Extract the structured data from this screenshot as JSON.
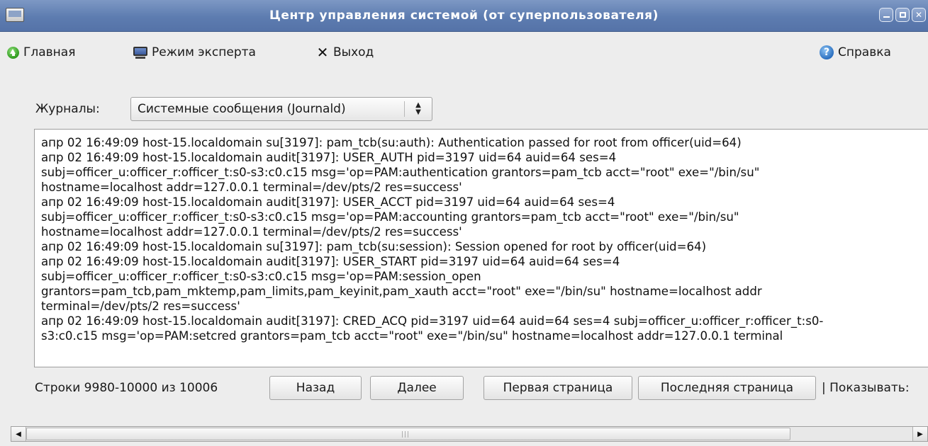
{
  "window": {
    "title": "Центр управления системой (от суперпользователя)",
    "buttons": {
      "minimize": "minimize",
      "maximize": "maximize",
      "close": "✕"
    }
  },
  "toolbar": {
    "home_label": "Главная",
    "expert_label": "Режим эксперта",
    "exit_label": "Выход",
    "help_label": "Справка"
  },
  "journals": {
    "label": "Журналы:",
    "selected": "Системные сообщения (Journald)"
  },
  "log": {
    "lines": [
      "апр 02 16:49:09 host-15.localdomain su[3197]: pam_tcb(su:auth): Authentication passed for root from officer(uid=64)",
      "апр 02 16:49:09 host-15.localdomain audit[3197]: USER_AUTH pid=3197 uid=64 auid=64 ses=4",
      "subj=officer_u:officer_r:officer_t:s0-s3:c0.c15 msg='op=PAM:authentication grantors=pam_tcb acct=\"root\" exe=\"/bin/su\"",
      "hostname=localhost addr=127.0.0.1 terminal=/dev/pts/2 res=success'",
      "апр 02 16:49:09 host-15.localdomain audit[3197]: USER_ACCT pid=3197 uid=64 auid=64 ses=4",
      "subj=officer_u:officer_r:officer_t:s0-s3:c0.c15 msg='op=PAM:accounting grantors=pam_tcb acct=\"root\" exe=\"/bin/su\"",
      "hostname=localhost addr=127.0.0.1 terminal=/dev/pts/2 res=success'",
      "апр 02 16:49:09 host-15.localdomain su[3197]: pam_tcb(su:session): Session opened for root by officer(uid=64)",
      "апр 02 16:49:09 host-15.localdomain audit[3197]: USER_START pid=3197 uid=64 auid=64 ses=4",
      "subj=officer_u:officer_r:officer_t:s0-s3:c0.c15 msg='op=PAM:session_open",
      "grantors=pam_tcb,pam_mktemp,pam_limits,pam_keyinit,pam_xauth acct=\"root\" exe=\"/bin/su\" hostname=localhost addr",
      "terminal=/dev/pts/2 res=success'",
      "апр 02 16:49:09 host-15.localdomain audit[3197]: CRED_ACQ pid=3197 uid=64 auid=64 ses=4 subj=officer_u:officer_r:officer_t:s0-",
      "s3:c0.c15 msg='op=PAM:setcred grantors=pam_tcb acct=\"root\" exe=\"/bin/su\" hostname=localhost addr=127.0.0.1 terminal"
    ]
  },
  "pager": {
    "info": "Строки 9980-10000 из 10006",
    "back_label": "Назад",
    "next_label": "Далее",
    "first_label": "Первая страница",
    "last_label": "Последняя страница",
    "show_label": "| Показывать:"
  },
  "scrollbar": {
    "left_arrow": "◀",
    "right_arrow": "▶",
    "grip": "|||"
  }
}
